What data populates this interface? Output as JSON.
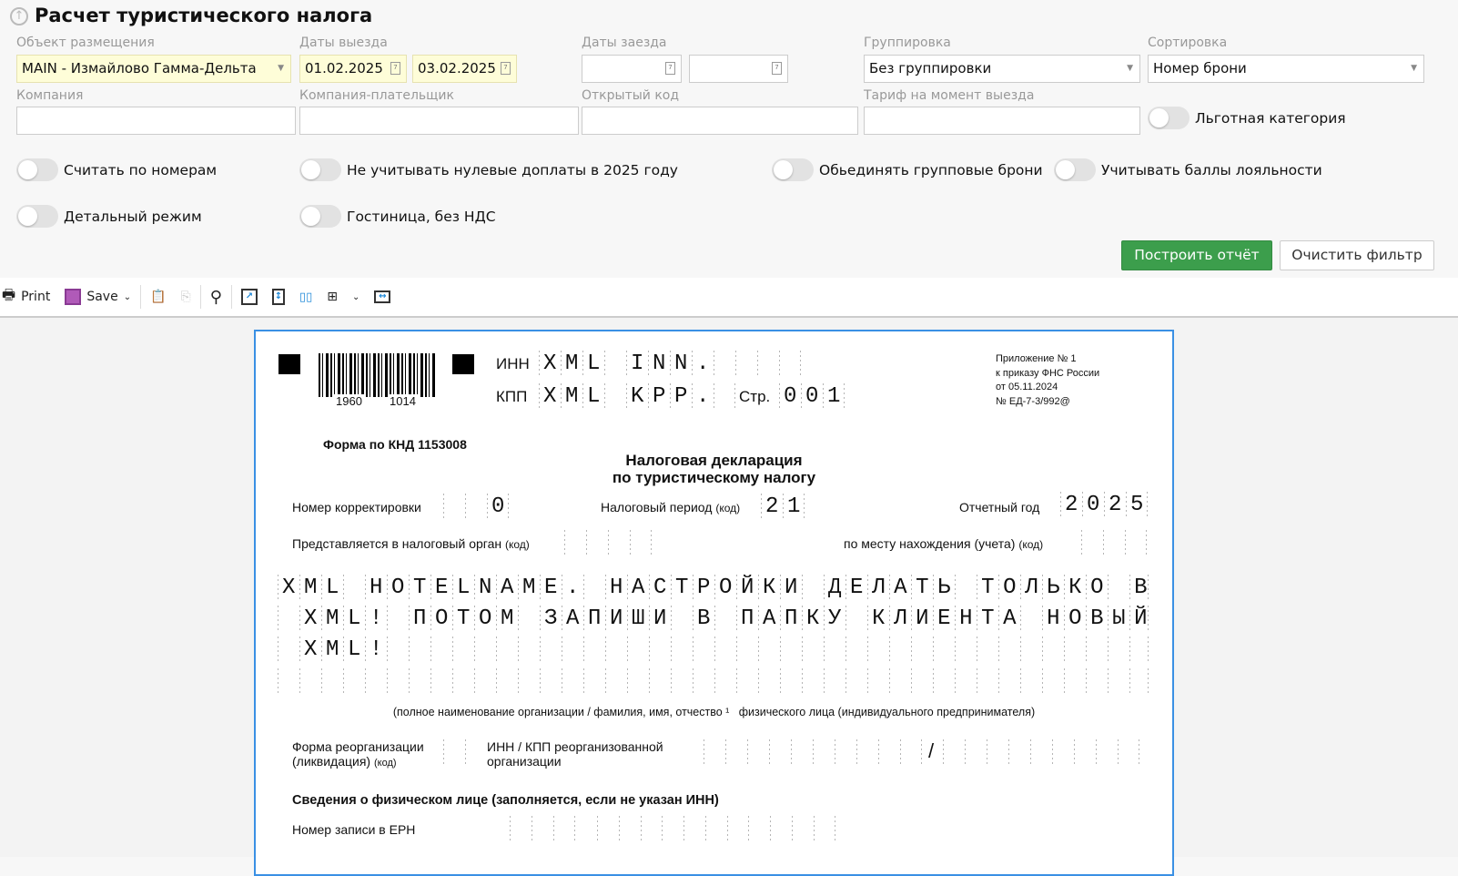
{
  "header": {
    "title": "Расчет туристического налога"
  },
  "filters": {
    "object": {
      "label": "Объект размещения",
      "value": "MAIN - Измайлово Гамма-Дельта"
    },
    "checkout": {
      "label": "Даты выезда",
      "from": "01.02.2025",
      "to": "03.02.2025"
    },
    "checkin": {
      "label": "Даты заезда",
      "from": "",
      "to": ""
    },
    "grouping": {
      "label": "Группировка",
      "value": "Без группировки"
    },
    "sorting": {
      "label": "Сортировка",
      "value": "Номер брони"
    },
    "company": {
      "label": "Компания",
      "value": ""
    },
    "payer": {
      "label": "Компания-плательщик",
      "value": ""
    },
    "open_code": {
      "label": "Открытый код",
      "value": ""
    },
    "tariff": {
      "label": "Тариф на момент выезда",
      "value": ""
    }
  },
  "toggles": {
    "preferential": "Льготная категория",
    "by_rooms": "Считать по номерам",
    "ignore_zero": "Не учитывать нулевые доплаты в 2025 году",
    "merge_group": "Обьединять групповые брони",
    "loyalty": "Учитывать баллы лояльности",
    "detailed": "Детальный режим",
    "hotel_no_vat": "Гостиница, без НДС"
  },
  "buttons": {
    "build": "Построить отчёт",
    "clear": "Очистить фильтр"
  },
  "colors": {
    "build": "#3c9e4c",
    "page_border": "#3a90e4"
  },
  "toolbar": {
    "print": "Print",
    "save": "Save"
  },
  "doc": {
    "barcode_left": "1960",
    "barcode_right": "1014",
    "inn_label": "ИНН",
    "inn": "XML INN.    ",
    "kpp_label": "КПП",
    "kpp": "XML KPP. ",
    "page_label": "Стр.",
    "page": "001",
    "appendix": [
      "Приложение № 1",
      "к приказу ФНС России",
      "от 05.11.2024",
      "№ ЕД-7-3/992@"
    ],
    "knd": "Форма по КНД 1153008",
    "title1": "Налоговая декларация",
    "title2": "по туристическому налогу",
    "correction_label": "Номер корректировки",
    "correction": "  0",
    "period_label": "Налоговый период",
    "period_code": "(код)",
    "period": "21",
    "year_label": "Отчетный год",
    "year": "2025",
    "authority_label": "Представляется в налоговый орган",
    "authority_code": "(код)",
    "authority": "    ",
    "location_label": "по месту нахождения (учета)",
    "location_code": "(код)",
    "location": "   ",
    "name_lines": [
      "XML HOTELNAME. НАСТРОЙКИ ДЕЛАТЬ ТОЛЬКО В",
      " XML! ПОТОМ ЗАПИШИ В ПАПКУ КЛИЕНТА НОВЫЙ",
      " XML!                                   ",
      "                                        "
    ],
    "name_caption": "(полное наименование организации / фамилия, имя, отчество ¹   физического лица (индивидуального предпринимателя)",
    "reorg_label1": "Форма реорганизации",
    "reorg_label2": "(ликвидация)",
    "reorg_code": "(код)",
    "reorg_inn_label1": "ИНН / КПП реорганизованной",
    "reorg_inn_label2": "организации",
    "slash": "/",
    "person_heading": "Сведения о физическом лице (заполняется, если не указан ИНН)",
    "ern_label": "Номер записи в ЕРН"
  }
}
